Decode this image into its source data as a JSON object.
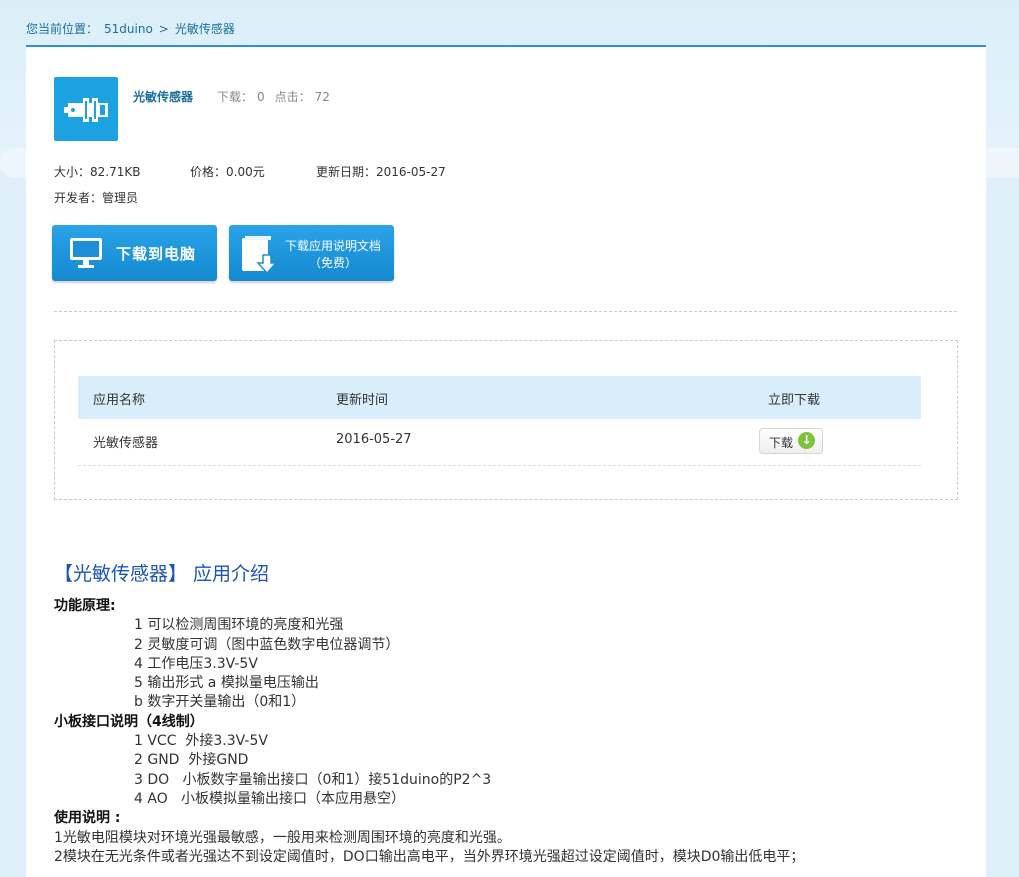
{
  "breadcrumb": {
    "prefix": "您当前位置：",
    "home": "51duino",
    "sep": ">",
    "current": "光敏传感器"
  },
  "app": {
    "title": "光敏传感器",
    "downloads_label": "下载：",
    "downloads": "0",
    "clicks_label": "点击：",
    "clicks": "72",
    "size_label": "大小：",
    "size": "82.71KB",
    "price_label": "价格：",
    "price": "0.00元",
    "date_label": "更新日期：",
    "date": "2016-05-27",
    "dev_label": "开发者：",
    "dev": "管理员"
  },
  "buttons": {
    "download_pc": "下载到电脑",
    "download_doc_line1": "下载应用说明文档",
    "download_doc_line2": "（免费）"
  },
  "table": {
    "headers": [
      "应用名称",
      "更新时间",
      "立即下载"
    ],
    "rows": [
      {
        "name": "光敏传感器",
        "date": "2016-05-27",
        "action": "下载"
      }
    ]
  },
  "intro": {
    "title": "【光敏传感器】 应用介绍",
    "principle_h": "功能原理:",
    "principle": [
      "1 可以检测周围环境的亮度和光强",
      "2 灵敏度可调（图中蓝色数字电位器调节）",
      "4 工作电压3.3V-5V",
      "5 输出形式 a 模拟量电压输出",
      "b 数字开关量输出（0和1）"
    ],
    "interface_h": "小板接口说明（4线制）",
    "interface": [
      "1 VCC  外接3.3V-5V",
      "2 GND  外接GND",
      "3 DO   小板数字量输出接口（0和1）接51duino的P2^3",
      "4 AO   小板模拟量输出接口（本应用悬空）"
    ],
    "usage_h": "使用说明 :",
    "usage": [
      "1光敏电阻模块对环境光强最敏感，一般用来检测周围环境的亮度和光强。",
      "2模块在无光条件或者光强达不到设定阈值时，DO口输出高电平，当外界环境光强超过设定阈值时，模块D0输出低电平；"
    ]
  }
}
